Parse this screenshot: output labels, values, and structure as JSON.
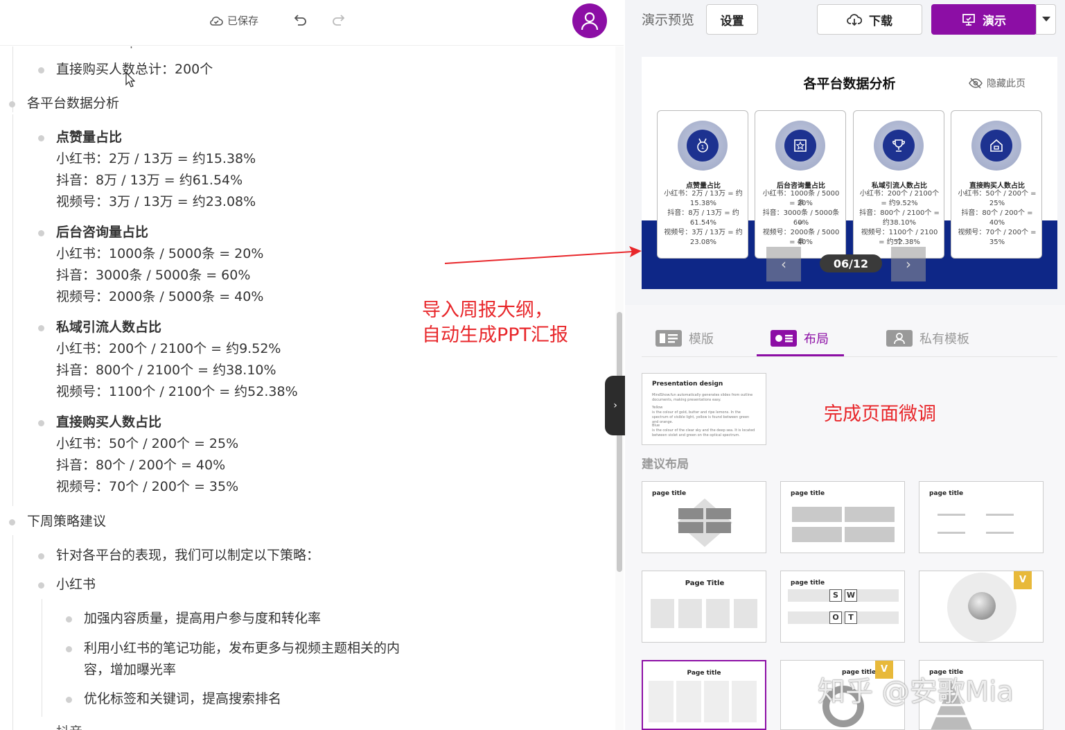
{
  "toolbar": {
    "saved_label": "已保存",
    "undo_icon": "undo-icon",
    "redo_icon": "redo-icon",
    "avatar_icon": "user-icon",
    "accent": "#8c0ea5"
  },
  "outline": {
    "truncated_top": "个",
    "line_buy_total": "直接购买人数总计：200个",
    "section_platform": "各平台数据分析",
    "groups": [
      {
        "heading": "点赞量占比",
        "lines": [
          "小红书：2万 / 13万 = 约15.38%",
          "抖音：8万 / 13万 = 约61.54%",
          "视频号：3万 / 13万 = 约23.08%"
        ]
      },
      {
        "heading": "后台咨询量占比",
        "lines": [
          "小红书：1000条 / 5000条 = 20%",
          "抖音：3000条 / 5000条 = 60%",
          "视频号：2000条 / 5000条 = 40%"
        ]
      },
      {
        "heading": "私域引流人数占比",
        "lines": [
          "小红书：200个 / 2100个 = 约9.52%",
          "抖音：800个 / 2100个 = 约38.10%",
          "视频号：1100个 / 2100个 = 约52.38%"
        ]
      },
      {
        "heading": "直接购买人数占比",
        "lines": [
          "小红书：50个 / 200个 = 25%",
          "抖音：80个 / 200个 = 40%",
          "视频号：70个 / 200个 = 35%"
        ]
      }
    ],
    "section_strategy": "下周策略建议",
    "strategy_intro": "针对各平台的表现，我们可以制定以下策略：",
    "strategy_xhs": "小红书",
    "xhs_items": [
      "加强内容质量，提高用户参与度和转化率",
      "利用小红书的笔记功能，发布更多与视频主题相关的内",
      "容，增加曝光率",
      "优化标签和关键词，提高搜索排名"
    ],
    "truncated_bottom": "抖音"
  },
  "annotations": {
    "left_line1": "导入周报大纲，",
    "left_line2": "自动生成PPT汇报",
    "right": "完成页面微调",
    "color": "#e8262a"
  },
  "right_header": {
    "preview_label": "演示预览",
    "settings_label": "设置",
    "download_label": "下载",
    "present_label": "演示"
  },
  "slide": {
    "title": "各平台数据分析",
    "hide_label": "隐藏此页",
    "pager": "06/12",
    "cards": [
      {
        "icon": "medal-icon",
        "title": "点赞量占比",
        "lines": [
          "小红书：2万 / 13万 = 约",
          "15.38%",
          "抖音：8万 / 13万 = 约",
          "61.54%",
          "视频号：3万 / 13万 = 约",
          "23.08%"
        ]
      },
      {
        "icon": "star-badge-icon",
        "title": "后台咨询量占比",
        "lines": [
          "小红书：1000条 / 5000条",
          "= 20%",
          "抖音：3000条 / 5000条 =",
          "60%",
          "视频号：2000条 / 5000条",
          "= 40%"
        ]
      },
      {
        "icon": "trophy-icon",
        "title": "私域引流人数占比",
        "lines": [
          "小红书：200个 / 2100个",
          "= 约9.52%",
          "抖音：800个 / 2100个 =",
          "约38.10%",
          "视频号：1100个 / 2100个",
          "= 约52.38%"
        ]
      },
      {
        "icon": "house-icon",
        "title": "直接购买人数占比",
        "lines": [
          "小红书：50个 / 200个 =",
          "25%",
          "抖音：80个 / 200个 =",
          "40%",
          "视频号：70个 / 200个 =",
          "35%"
        ]
      }
    ],
    "band_color": "#0e2787"
  },
  "tabs": [
    {
      "label": "模版",
      "icon": "template-icon"
    },
    {
      "label": "布局",
      "icon": "layout-icon",
      "active": true
    },
    {
      "label": "私有模板",
      "icon": "private-template-icon"
    }
  ],
  "current_layout": {
    "title": "Presentation design",
    "text1": "MindShow.fun automatically generates slides from outline documents, making presentations easy.",
    "text2": "Yellow",
    "text3": "is the colour of gold, butter and ripe lemons. In the spectrum of visible light, yellow is found between green and orange.",
    "text4": "Blue",
    "text5": "is the colour of the clear sky and the deep sea. It is located between violet and green on the optical spectrum."
  },
  "suggest_label": "建议布局",
  "layouts": [
    {
      "title": "page title"
    },
    {
      "title": "page title"
    },
    {
      "title": "page title"
    },
    {
      "title": "Page Title"
    },
    {
      "title": "page title",
      "swot": [
        "S",
        "W",
        "O",
        "T"
      ]
    },
    {
      "title": ""
    },
    {
      "title": "Page title"
    },
    {
      "title": "page title"
    },
    {
      "title": "page title"
    }
  ],
  "watermark": "知乎 @安歌Mia"
}
